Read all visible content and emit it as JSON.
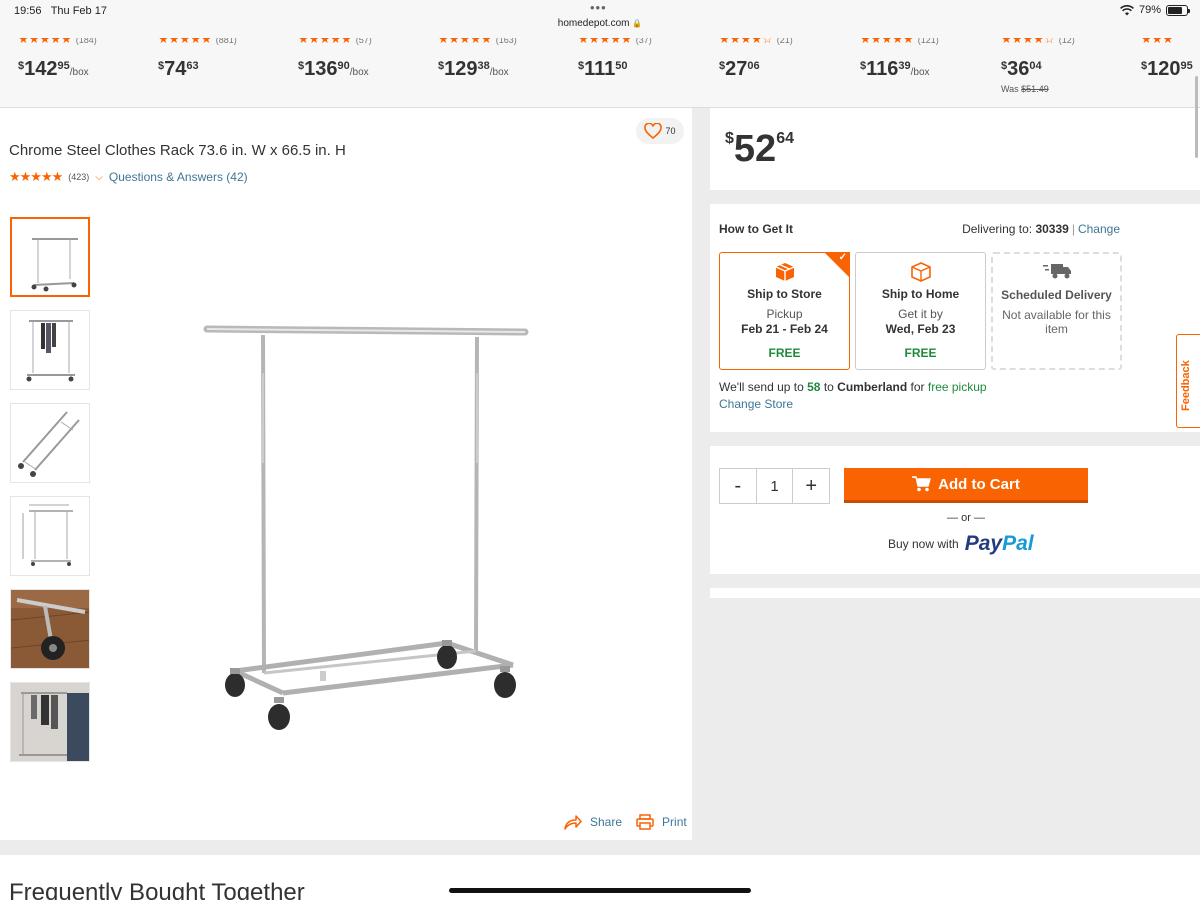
{
  "status_bar": {
    "time": "19:56",
    "date": "Thu Feb 17",
    "url": "homedepot.com",
    "battery": "79%",
    "battery_level": 0.79
  },
  "carousel": [
    {
      "stars": "★★★★★",
      "count": "(184)",
      "dollar": "$",
      "whole": "142",
      "cents": "95",
      "unit": "/box"
    },
    {
      "stars": "★★★★★",
      "count": "(881)",
      "dollar": "$",
      "whole": "74",
      "cents": "63",
      "unit": ""
    },
    {
      "stars": "★★★★★",
      "count": "(57)",
      "dollar": "$",
      "whole": "136",
      "cents": "90",
      "unit": "/box"
    },
    {
      "stars": "★★★★★",
      "count": "(163)",
      "dollar": "$",
      "whole": "129",
      "cents": "38",
      "unit": "/box"
    },
    {
      "stars": "★★★★★",
      "count": "(37)",
      "dollar": "$",
      "whole": "111",
      "cents": "50",
      "unit": ""
    },
    {
      "stars": "★★★★☆",
      "count": "(21)",
      "dollar": "$",
      "whole": "27",
      "cents": "06",
      "unit": ""
    },
    {
      "stars": "★★★★★",
      "count": "(121)",
      "dollar": "$",
      "whole": "116",
      "cents": "39",
      "unit": "/box"
    },
    {
      "stars": "★★★★☆",
      "count": "(12)",
      "dollar": "$",
      "whole": "36",
      "cents": "04",
      "unit": "",
      "was_label": "Was ",
      "was_price": "$51.49"
    },
    {
      "stars": "★★★",
      "count": "",
      "dollar": "$",
      "whole": "120",
      "cents": "95",
      "unit": ""
    }
  ],
  "product": {
    "favorite_count": "70",
    "title": "Chrome Steel Clothes Rack 73.6 in. W x 66.5 in. H",
    "stars": "★★★★★",
    "rating_value": 4.5,
    "review_count": "(423)",
    "qa_link": "Questions & Answers (42)",
    "share": "Share",
    "print": "Print"
  },
  "price": {
    "dollar": "$",
    "whole": "52",
    "cents": "64"
  },
  "fulfillment": {
    "title": "How to Get It",
    "delivering_label": "Delivering to:",
    "zip": "30339",
    "separator": "|",
    "change": "Change",
    "options": [
      {
        "name": "Ship to Store",
        "line1": "Pickup",
        "line2": "Feb 21 - Feb 24",
        "price": "FREE"
      },
      {
        "name": "Ship to Home",
        "line1": "Get it by",
        "line2": "Wed, Feb 23",
        "price": "FREE"
      },
      {
        "name": "Scheduled Delivery",
        "line1": "Not available for this item"
      }
    ],
    "pickup_pre": "We'll send up to ",
    "pickup_qty": "58",
    "pickup_mid": " to ",
    "pickup_store": "Cumberland",
    "pickup_for": " for ",
    "pickup_free": "free pickup",
    "change_store": "Change Store"
  },
  "cart": {
    "minus": "-",
    "quantity": "1",
    "plus": "+",
    "add_to_cart": "Add to Cart",
    "or": "— or —",
    "buy_now": "Buy now with",
    "paypal_1": "Pay",
    "paypal_2": "Pal"
  },
  "feedback": "Feedback",
  "section_heading": "Frequently Bought Together",
  "colors": {
    "brand_orange": "#f96302",
    "link_blue": "#3e7697",
    "free_green": "#208a3c"
  }
}
